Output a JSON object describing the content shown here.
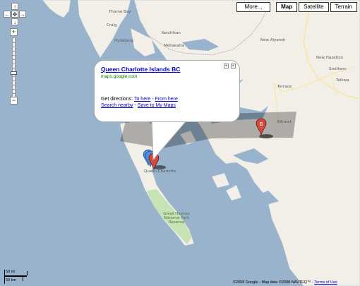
{
  "info_window": {
    "title": "Queen Charlotte Islands BC",
    "host": "maps.google.com",
    "directions_prefix": "Get directions:",
    "to_here": "To here",
    "separator": "-",
    "from_here": "From here",
    "search_nearby": "Search nearby",
    "save_to_maps": "Save to My Maps"
  },
  "map_types": {
    "more": "More...",
    "map": "Map",
    "satellite": "Satellite",
    "terrain": "Terrain",
    "active": "Map"
  },
  "pan_icons": {
    "up": "↑",
    "left": "←",
    "center": "✥",
    "right": "→",
    "down": "↓"
  },
  "zoom": {
    "plus": "+",
    "minus": "−",
    "level_fraction": 0.5
  },
  "places": {
    "thorne_bay": "Thorne Bay",
    "craig": "Craig",
    "hydaburg": "Hydaburg",
    "ketchikan": "Ketchikan",
    "metlakatla": "Metlakatla",
    "new_ayansh": "New Aiyansh",
    "new_hazelton": "New Hazelton",
    "smithers": "Smithers",
    "telkwa": "Telkwa",
    "terrace": "Terrace",
    "kitimat": "Kitimat",
    "queen_charlotte": "Queen Charlotte",
    "gwaii_haanas": "Gwaii Haanas National Park Reserve"
  },
  "markers": [
    {
      "label": "B",
      "color": "#d24b3c"
    },
    {
      "label": "F",
      "color": "#d24b3c"
    }
  ],
  "scale": {
    "miles": "50 mi",
    "km": "50 km"
  },
  "copyright": {
    "text": "©2008 Google - Map data ©2008 NAVTEQ™ -",
    "terms": "Terms of Use"
  },
  "colors": {
    "water": "#99b3cc",
    "land": "#f2efe9",
    "park": "#c7e2b4",
    "road": "#f6e7a2",
    "link": "#0000cc",
    "host": "#008000"
  }
}
